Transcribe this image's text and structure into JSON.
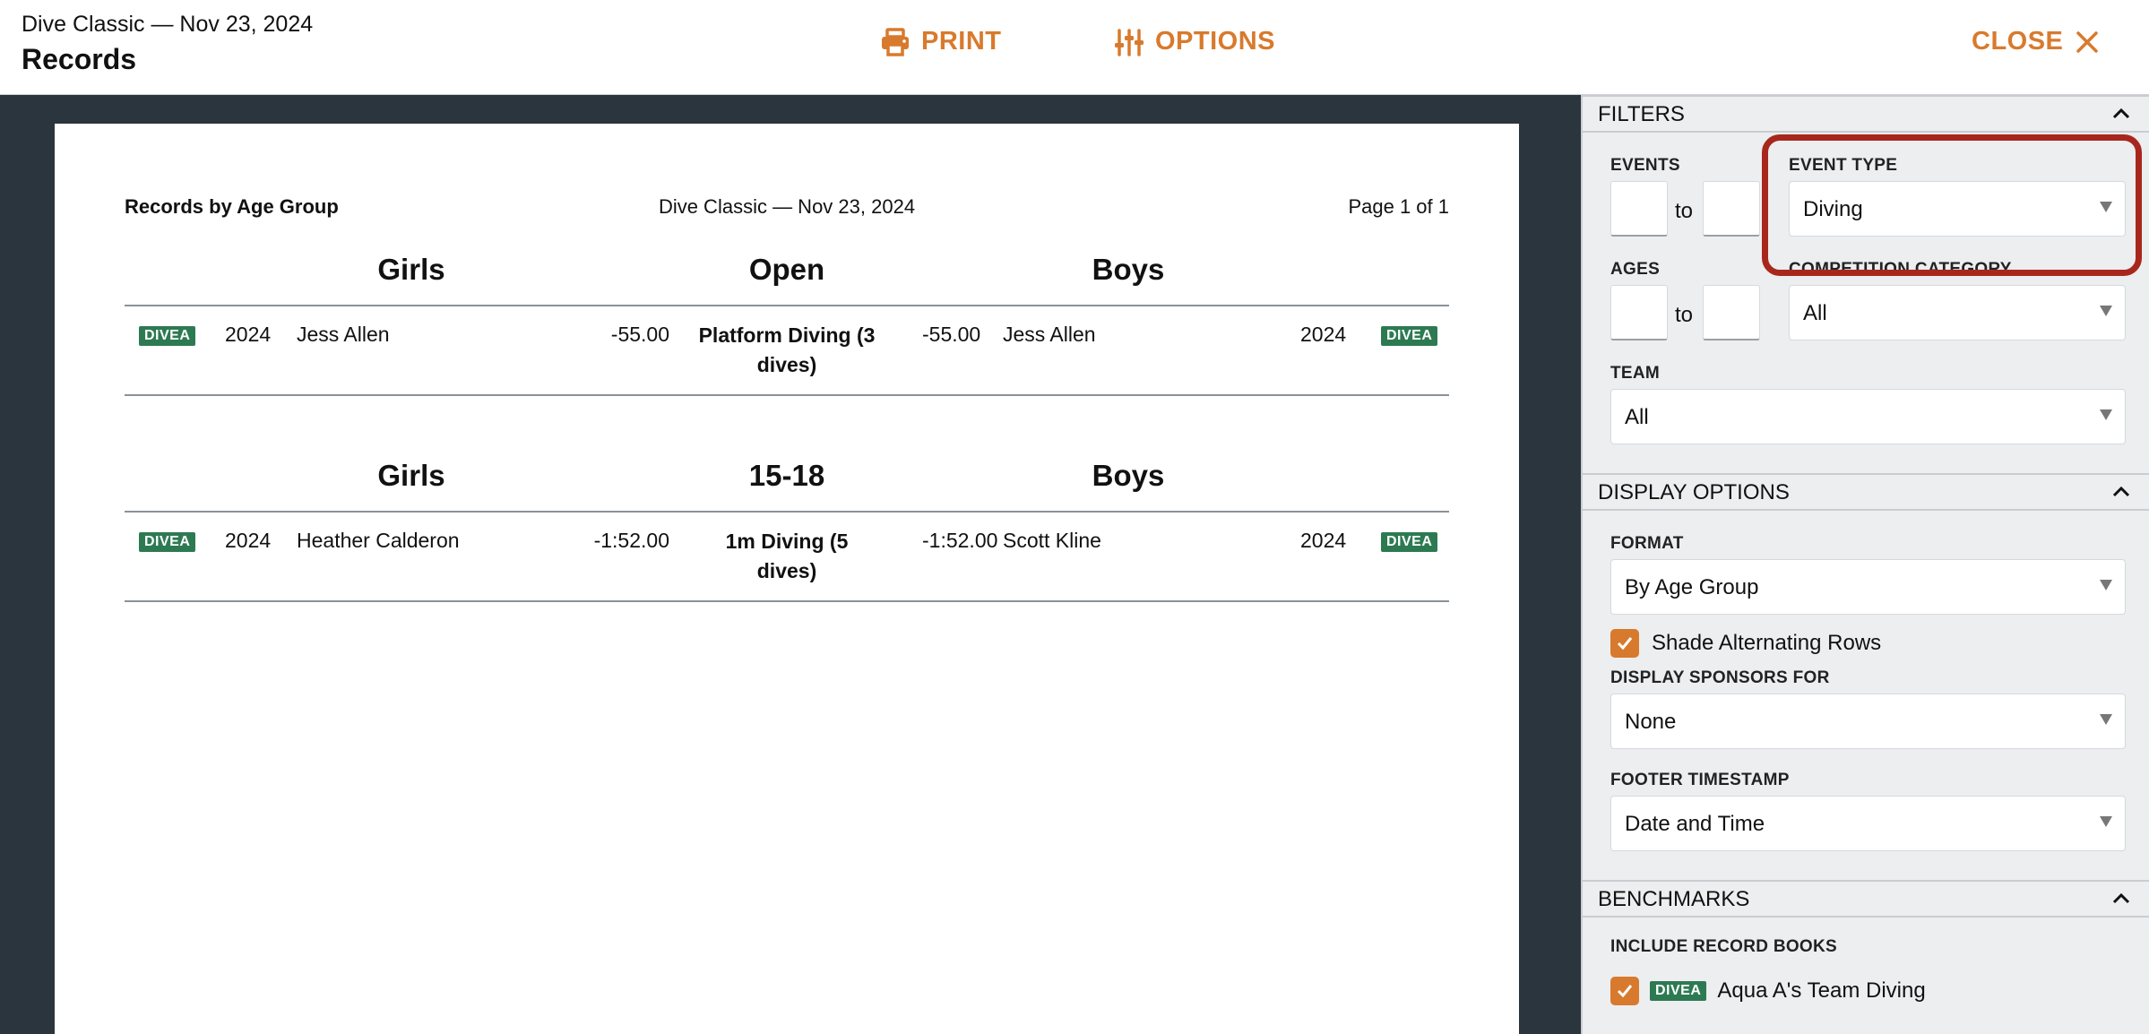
{
  "header": {
    "subtitle": "Dive Classic — Nov 23, 2024",
    "title": "Records",
    "print_label": "PRINT",
    "options_label": "OPTIONS",
    "close_label": "CLOSE"
  },
  "document": {
    "report_title": "Records by Age Group",
    "meet_title": "Dive Classic — Nov 23, 2024",
    "page_info": "Page 1 of 1",
    "groups": [
      {
        "girls": "Girls",
        "age": "Open",
        "boys": "Boys",
        "row": {
          "badge_left": "DIVEA",
          "year_left": "2024",
          "name_left": "Jess Allen",
          "time_left": "-55.00",
          "event": "Platform Diving (3 dives)",
          "time_right": "-55.00",
          "name_right": "Jess Allen",
          "year_right": "2024",
          "badge_right": "DIVEA"
        }
      },
      {
        "girls": "Girls",
        "age": "15-18",
        "boys": "Boys",
        "row": {
          "badge_left": "DIVEA",
          "year_left": "2024",
          "name_left": "Heather Calderon",
          "time_left": "-1:52.00",
          "event": "1m Diving (5 dives)",
          "time_right": "-1:52.00",
          "name_right": "Scott Kline",
          "year_right": "2024",
          "badge_right": "DIVEA"
        }
      }
    ]
  },
  "panel": {
    "filters": {
      "heading": "FILTERS",
      "events_label": "EVENTS",
      "to1": "to",
      "event_type_label": "EVENT TYPE",
      "event_type_value": "Diving",
      "ages_label": "AGES",
      "to2": "to",
      "competition_category_label": "COMPETITION CATEGORY",
      "competition_category_value": "All",
      "team_label": "TEAM",
      "team_value": "All"
    },
    "display_options": {
      "heading": "DISPLAY OPTIONS",
      "format_label": "FORMAT",
      "format_value": "By Age Group",
      "shade_label": "Shade Alternating Rows",
      "shade_checked": true,
      "sponsors_label": "DISPLAY SPONSORS FOR",
      "sponsors_value": "None",
      "footer_label": "FOOTER TIMESTAMP",
      "footer_value": "Date and Time"
    },
    "benchmarks": {
      "heading": "BENCHMARKS",
      "include_label": "INCLUDE RECORD BOOKS",
      "record_badge": "DIVEA",
      "record_name": "Aqua A's Team Diving",
      "record_checked": true
    }
  },
  "colors": {
    "accent": "#d87a2d",
    "badge": "#2d7a52",
    "preview_bg": "#2b353d",
    "highlight": "#a8271d"
  }
}
